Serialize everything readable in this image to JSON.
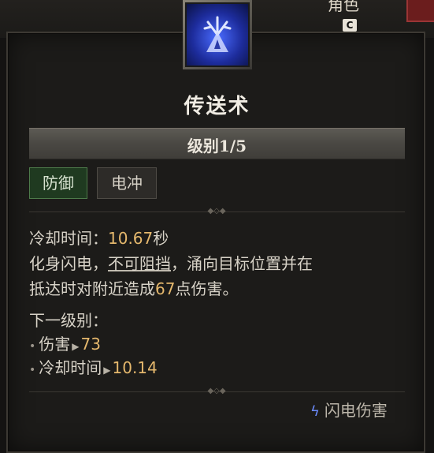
{
  "top": {
    "menu_label": "角色",
    "key_hint": "C"
  },
  "skill": {
    "icon": "lightning-skill-icon",
    "name": "传送术",
    "level_label": "级别1/5",
    "tags": [
      "防御",
      "电冲"
    ]
  },
  "description": {
    "cooldown_label": "冷却时间：",
    "cooldown_value": "10.67",
    "cooldown_unit": "秒",
    "line2_a": "化身闪电，",
    "line2_b": "不可阻挡",
    "line2_c": "，涌向目标位置并在",
    "line3_a": "抵达时对附近造成",
    "line3_value": "67",
    "line3_b": "点伤害。"
  },
  "next_level": {
    "heading": "下一级别：",
    "items": [
      {
        "label": "伤害",
        "value": "73"
      },
      {
        "label": "冷却时间",
        "value": "10.14"
      }
    ]
  },
  "footer": {
    "damage_type": "闪电伤害"
  },
  "colors": {
    "accent_number": "#e5b86d",
    "tag_defense_bg": "#1f3a20",
    "icon_blue": "#4a6cff"
  }
}
